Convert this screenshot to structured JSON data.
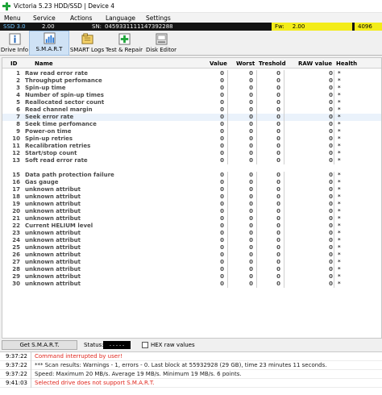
{
  "window": {
    "title": "Victoria 5.23 HDD/SSD | Device 4"
  },
  "menu": [
    "Menu",
    "Service",
    "Actions",
    "Language",
    "Settings"
  ],
  "device": {
    "type": "SSD 3.0",
    "model": "2.00",
    "sn_label": "SN:",
    "sn": "0459331111147392288",
    "fw_label": "Fw:",
    "fw": "2.00",
    "capacity": "4096"
  },
  "toolbar": [
    "Drive Info",
    "S.M.A.R.T",
    "SMART Logs",
    "Test & Repair",
    "Disk Editor"
  ],
  "table": {
    "headers": {
      "id": "ID",
      "name": "Name",
      "value": "Value",
      "worst": "Worst",
      "threshold": "Treshold",
      "raw": "RAW value",
      "health": "Health"
    },
    "rows": [
      {
        "id": "1",
        "name": "Raw read error rate",
        "value": "0",
        "worst": "0",
        "threshold": "0",
        "raw": "0",
        "health": "*"
      },
      {
        "id": "2",
        "name": "Throughput perfomance",
        "value": "0",
        "worst": "0",
        "threshold": "0",
        "raw": "0",
        "health": "*"
      },
      {
        "id": "3",
        "name": "Spin-up time",
        "value": "0",
        "worst": "0",
        "threshold": "0",
        "raw": "0",
        "health": "*"
      },
      {
        "id": "4",
        "name": "Number of spin-up times",
        "value": "0",
        "worst": "0",
        "threshold": "0",
        "raw": "0",
        "health": "*"
      },
      {
        "id": "5",
        "name": "Reallocated sector count",
        "value": "0",
        "worst": "0",
        "threshold": "0",
        "raw": "0",
        "health": "*"
      },
      {
        "id": "6",
        "name": "Read channel margin",
        "value": "0",
        "worst": "0",
        "threshold": "0",
        "raw": "0",
        "health": "*"
      },
      {
        "id": "7",
        "name": "Seek error rate",
        "value": "0",
        "worst": "0",
        "threshold": "0",
        "raw": "0",
        "health": "*"
      },
      {
        "id": "8",
        "name": "Seek time perfomance",
        "value": "0",
        "worst": "0",
        "threshold": "0",
        "raw": "0",
        "health": "*"
      },
      {
        "id": "9",
        "name": "Power-on time",
        "value": "0",
        "worst": "0",
        "threshold": "0",
        "raw": "0",
        "health": "*"
      },
      {
        "id": "10",
        "name": "Spin-up retries",
        "value": "0",
        "worst": "0",
        "threshold": "0",
        "raw": "0",
        "health": "*"
      },
      {
        "id": "11",
        "name": "Recalibration retries",
        "value": "0",
        "worst": "0",
        "threshold": "0",
        "raw": "0",
        "health": "*"
      },
      {
        "id": "12",
        "name": "Start/stop count",
        "value": "0",
        "worst": "0",
        "threshold": "0",
        "raw": "0",
        "health": "*"
      },
      {
        "id": "13",
        "name": "Soft read error rate",
        "value": "0",
        "worst": "0",
        "threshold": "0",
        "raw": "0",
        "health": "*"
      },
      {
        "id": "15",
        "name": "Data path protection failure",
        "value": "0",
        "worst": "0",
        "threshold": "0",
        "raw": "0",
        "health": "*"
      },
      {
        "id": "16",
        "name": "Gas gauge",
        "value": "0",
        "worst": "0",
        "threshold": "0",
        "raw": "0",
        "health": "*"
      },
      {
        "id": "17",
        "name": "unknown attribut",
        "value": "0",
        "worst": "0",
        "threshold": "0",
        "raw": "0",
        "health": "*"
      },
      {
        "id": "18",
        "name": "unknown attribut",
        "value": "0",
        "worst": "0",
        "threshold": "0",
        "raw": "0",
        "health": "*"
      },
      {
        "id": "19",
        "name": "unknown attribut",
        "value": "0",
        "worst": "0",
        "threshold": "0",
        "raw": "0",
        "health": "*"
      },
      {
        "id": "20",
        "name": "unknown attribut",
        "value": "0",
        "worst": "0",
        "threshold": "0",
        "raw": "0",
        "health": "*"
      },
      {
        "id": "21",
        "name": "unknown attribut",
        "value": "0",
        "worst": "0",
        "threshold": "0",
        "raw": "0",
        "health": "*"
      },
      {
        "id": "22",
        "name": "Current HELIUM level",
        "value": "0",
        "worst": "0",
        "threshold": "0",
        "raw": "0",
        "health": "*"
      },
      {
        "id": "23",
        "name": "unknown attribut",
        "value": "0",
        "worst": "0",
        "threshold": "0",
        "raw": "0",
        "health": "*"
      },
      {
        "id": "24",
        "name": "unknown attribut",
        "value": "0",
        "worst": "0",
        "threshold": "0",
        "raw": "0",
        "health": "*"
      },
      {
        "id": "25",
        "name": "unknown attribut",
        "value": "0",
        "worst": "0",
        "threshold": "0",
        "raw": "0",
        "health": "*"
      },
      {
        "id": "26",
        "name": "unknown attribut",
        "value": "0",
        "worst": "0",
        "threshold": "0",
        "raw": "0",
        "health": "*"
      },
      {
        "id": "27",
        "name": "unknown attribut",
        "value": "0",
        "worst": "0",
        "threshold": "0",
        "raw": "0",
        "health": "*"
      },
      {
        "id": "28",
        "name": "unknown attribut",
        "value": "0",
        "worst": "0",
        "threshold": "0",
        "raw": "0",
        "health": "*"
      },
      {
        "id": "29",
        "name": "unknown attribut",
        "value": "0",
        "worst": "0",
        "threshold": "0",
        "raw": "0",
        "health": "*"
      },
      {
        "id": "30",
        "name": "unknown attribut",
        "value": "0",
        "worst": "0",
        "threshold": "0",
        "raw": "0",
        "health": "*"
      }
    ],
    "selected_id": "7"
  },
  "status": {
    "get_smart": "Get S.M.A.R.T.",
    "status_label": "Status:",
    "status_value": "- - - - -",
    "hex_label": "HEX raw values"
  },
  "log": [
    {
      "time": "9:37:22",
      "msg": "Command interrupted by user!",
      "color": "red"
    },
    {
      "time": "9:37:22",
      "msg": "*** Scan results: Warnings - 1, errors - 0. Last block at 55932928 (29 GB), time 23 minutes 11 seconds.",
      "color": "black"
    },
    {
      "time": "9:37:22",
      "msg": "Speed: Maximum 20 MB/s. Average 19 MB/s. Minimum 19 MB/s. 6 points.",
      "color": "black"
    },
    {
      "time": "9:41:03",
      "msg": "Selected drive does not support S.M.A.R.T.",
      "color": "red"
    }
  ]
}
